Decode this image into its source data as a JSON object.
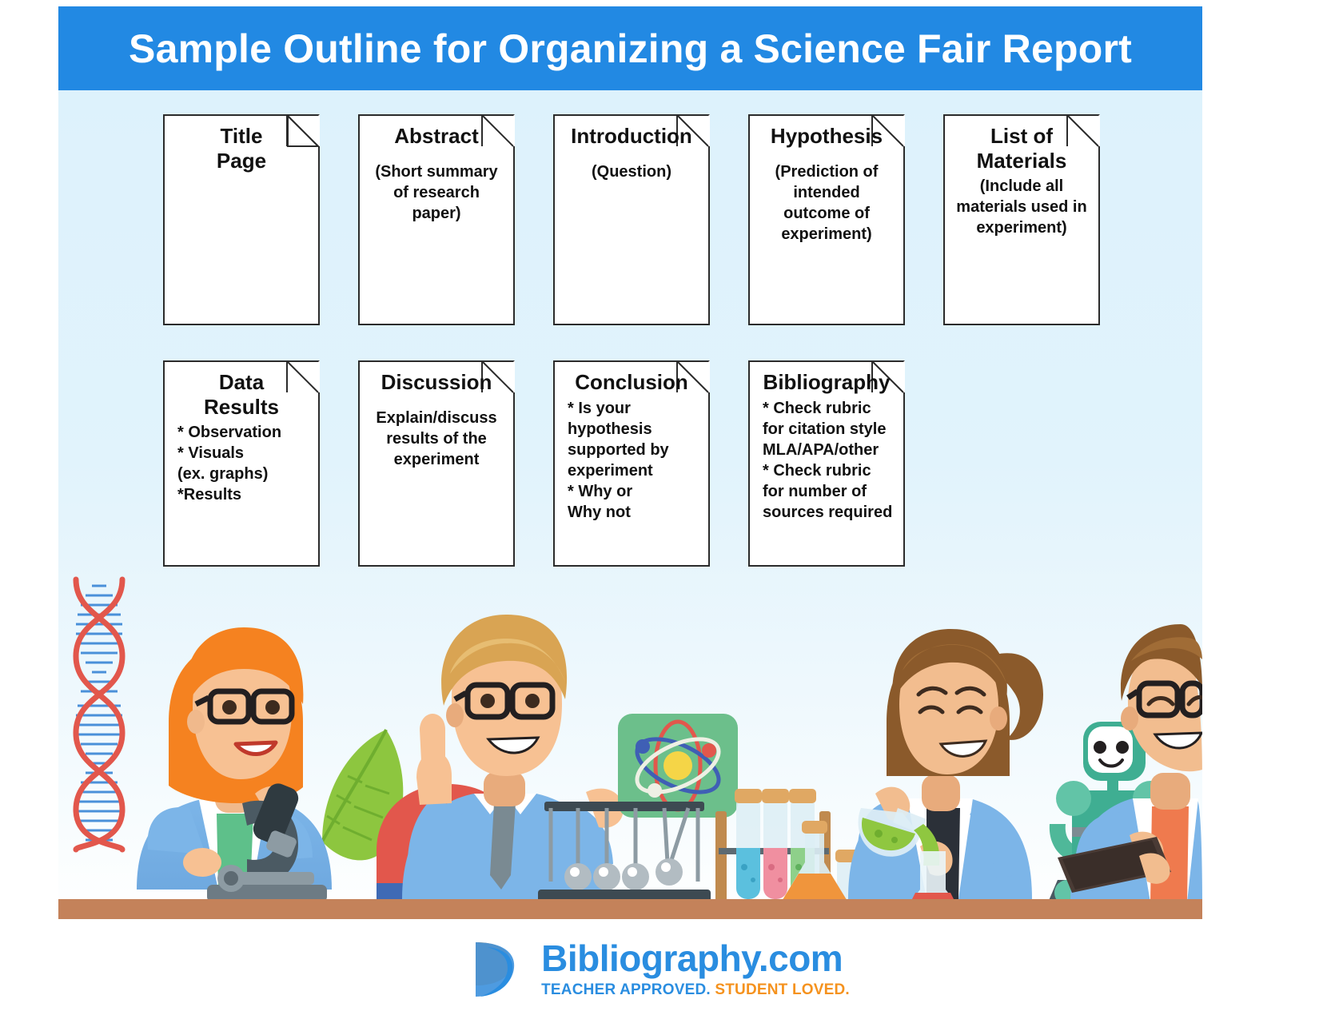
{
  "header": {
    "title": "Sample Outline for Organizing a Science Fair Report",
    "bar_color": "#2289e3"
  },
  "colors": {
    "header_blue": "#2289e3",
    "panel_top": "#ddf2fc",
    "panel_bottom": "#ffffff",
    "card_border": "#2b2b2b",
    "desk_top": "#c4825a",
    "desk_edge": "#a86a44",
    "logo_blue": "#2a8de0",
    "logo_orange": "#f5921e"
  },
  "cards": [
    {
      "id": "title-page",
      "title": "Title\nPage",
      "body": ""
    },
    {
      "id": "abstract",
      "title": "Abstract",
      "body": "(Short summary\nof research\npaper)"
    },
    {
      "id": "introduction",
      "title": "Introduction",
      "body": "(Question)"
    },
    {
      "id": "hypothesis",
      "title": "Hypothesis",
      "body": "(Prediction of\nintended\noutcome of\nexperiment)"
    },
    {
      "id": "list-of-materials",
      "title": "List of\nMaterials",
      "body": "(Include all\nmaterials used in\nexperiment)"
    },
    {
      "id": "data-results",
      "title": "Data\nResults",
      "body": "* Observation\n* Visuals\n  (ex. graphs)\n*Results"
    },
    {
      "id": "discussion",
      "title": "Discussion",
      "body": "Explain/discuss\nresults of the\nexperiment"
    },
    {
      "id": "conclusion",
      "title": "Conclusion",
      "body": "* Is your\n  hypothesis\n  supported by\n  experiment\n* Why or\n  Why not"
    },
    {
      "id": "bibliography",
      "title": "Bibliography",
      "body": "* Check rubric\nfor citation style\nMLA/APA/other\n* Check rubric\nfor number of\nsources required"
    }
  ],
  "illustration": {
    "items": [
      "dna-helix",
      "girl-scientist-microscope",
      "green-leaf",
      "horseshoe-magnet",
      "boy-scientist-atom-card",
      "newtons-cradle",
      "test-tube-rack",
      "erlenmeyer-flask",
      "girl-scientist-pouring",
      "green-robot",
      "boy-scientist-tablet",
      "lab-desk"
    ]
  },
  "footer": {
    "logo_name": "Bibliography.com",
    "tagline_part1": "TEACHER APPROVED.",
    "tagline_part2": "STUDENT LOVED."
  }
}
